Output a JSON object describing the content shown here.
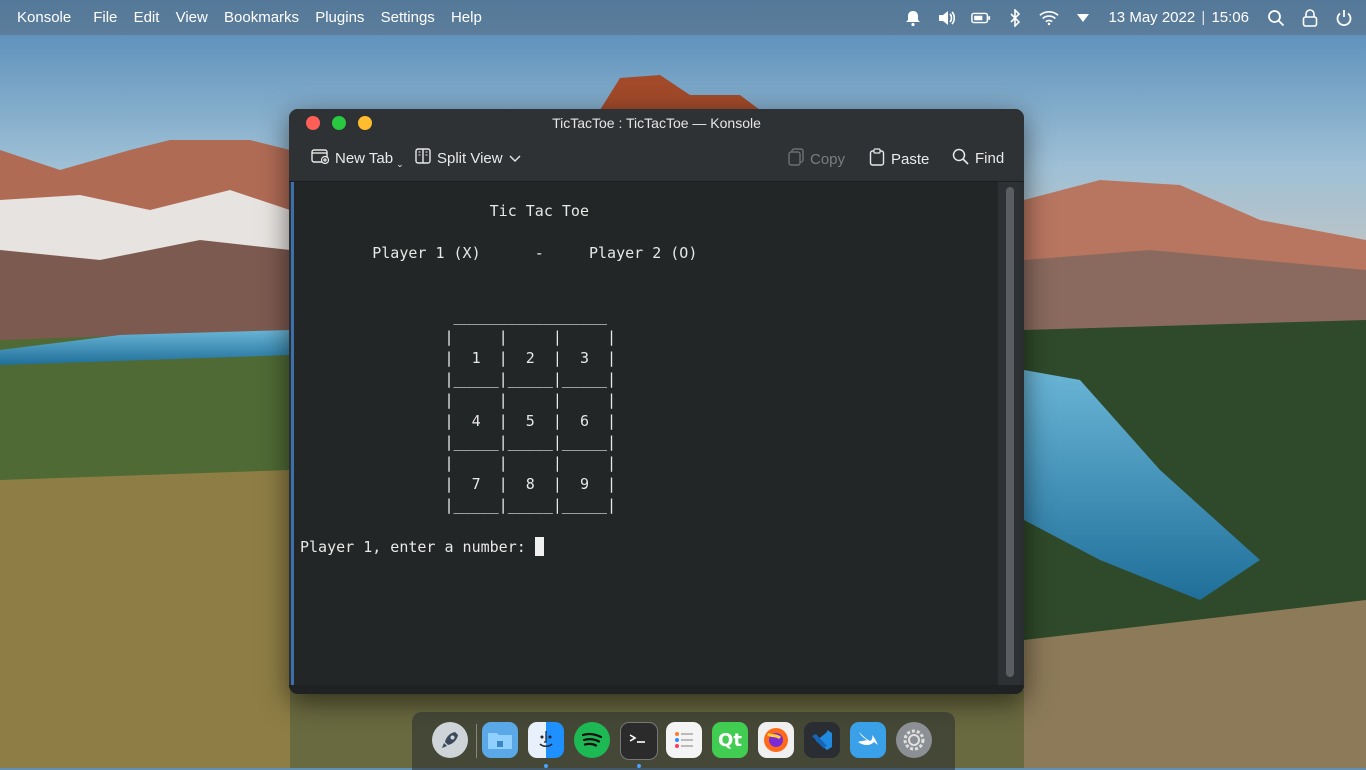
{
  "topbar": {
    "app_name": "Konsole",
    "menu": [
      "File",
      "Edit",
      "View",
      "Bookmarks",
      "Plugins",
      "Settings",
      "Help"
    ],
    "date": "13 May 2022",
    "time": "15:06"
  },
  "window": {
    "title": "TicTacToe : TicTacToe — Konsole",
    "toolbar": {
      "new_tab": "New Tab",
      "split_view": "Split View",
      "copy": "Copy",
      "paste": "Paste",
      "find": "Find"
    }
  },
  "terminal": {
    "output": "                     Tic Tac Toe\n\n        Player 1 (X)      -     Player 2 (O)\n\n\n                 _________________\n                |     |     |     |\n                |  1  |  2  |  3  |\n                |_____|_____|_____|\n                |     |     |     |\n                |  4  |  5  |  6  |\n                |_____|_____|_____|\n                |     |     |     |\n                |  7  |  8  |  9  |\n                |_____|_____|_____|\n\nPlayer 1, enter a number: "
  },
  "dock": {
    "items": [
      {
        "name": "launcher",
        "icon": "rocket-icon",
        "color": "#cfd4d8"
      },
      {
        "name": "files",
        "icon": "folder-icon",
        "color": "#5aa9e6"
      },
      {
        "name": "finder",
        "icon": "finder-icon",
        "color": "#1e90ff"
      },
      {
        "name": "spotify",
        "icon": "spotify-icon",
        "color": "#1db954"
      },
      {
        "name": "terminal",
        "icon": "terminal-icon",
        "color": "#2b2b2b"
      },
      {
        "name": "reminders",
        "icon": "list-icon",
        "color": "#f2f2f2"
      },
      {
        "name": "qt-creator",
        "icon": "qt-icon",
        "color": "#41cd52"
      },
      {
        "name": "firefox",
        "icon": "firefox-icon",
        "color": "#ff6a1a"
      },
      {
        "name": "vscode",
        "icon": "vscode-icon",
        "color": "#1f78d1"
      },
      {
        "name": "swift",
        "icon": "swift-bird-icon",
        "color": "#3aa0e8"
      },
      {
        "name": "settings",
        "icon": "gear-icon",
        "color": "#8c8f94"
      }
    ],
    "qt_label": "Qt"
  },
  "colors": {
    "close": "#ff5f57",
    "minimize": "#28c840",
    "maximize": "#febc2e",
    "terminal_bg": "#232627",
    "accent": "#3d6fa8"
  }
}
